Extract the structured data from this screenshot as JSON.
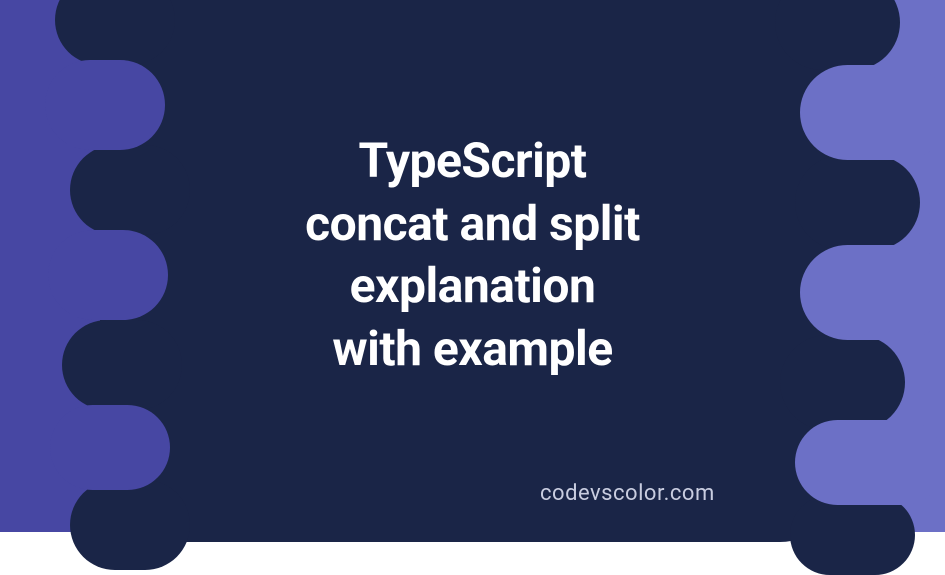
{
  "title_lines": {
    "l1": "TypeScript",
    "l2": "concat and split",
    "l3": "explanation",
    "l4": "with example"
  },
  "watermark": "codevscolor.com",
  "colors": {
    "bg_left": "#4747a3",
    "bg_right": "#6c70c6",
    "blob": "#1a2547",
    "text": "#ffffff",
    "watermark": "#c9cde0"
  }
}
